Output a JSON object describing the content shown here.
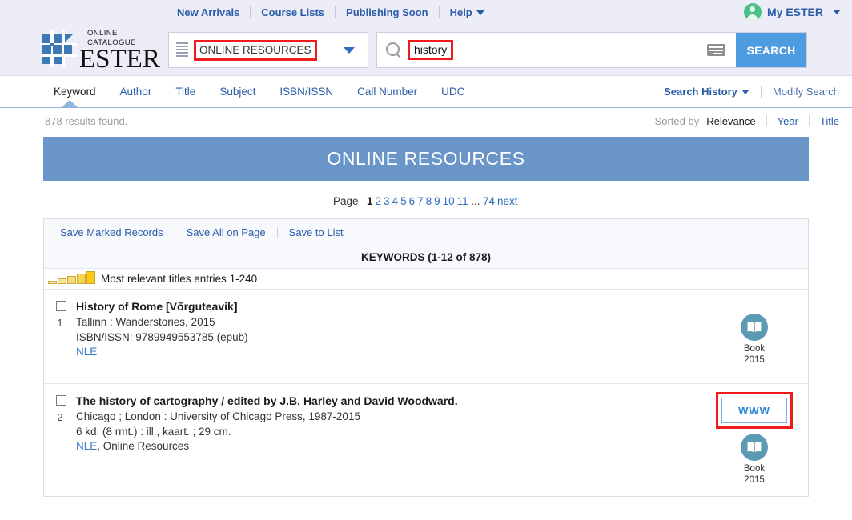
{
  "header": {
    "utility_nav": [
      {
        "label": "New Arrivals",
        "icon": null
      },
      {
        "label": "Course Lists",
        "icon": null
      },
      {
        "label": "Publishing Soon",
        "icon": null
      },
      {
        "label": "Help",
        "icon": "chevron-down-icon"
      }
    ],
    "account": {
      "label": "My ESTER",
      "avatar_icon": "user-avatar-icon",
      "avatar_color": "#4dc08a",
      "caret_icon": "chevron-down-icon"
    },
    "logo": {
      "subtitle": "ONLINE CATALOGUE",
      "title": "ESTER",
      "mark_icon": "ester-grid-logo-icon",
      "mark_color": "#3d79b5"
    },
    "scope_select": {
      "menu_icon": "hamburger-icon",
      "value": "ONLINE RESOURCES",
      "arrow_icon": "chevron-down-icon",
      "highlight_color": "#ee1c1c"
    },
    "search": {
      "search_icon": "magnifier-icon",
      "value": "history",
      "keyboard_icon": "virtual-keyboard-icon",
      "button_label": "SEARCH",
      "button_color": "#4d9ce0",
      "highlight_color": "#ee1c1c"
    },
    "band_color": "#ecedf7"
  },
  "tabbar": {
    "tabs": [
      {
        "label": "Keyword",
        "active": true
      },
      {
        "label": "Author",
        "active": false
      },
      {
        "label": "Title",
        "active": false
      },
      {
        "label": "Subject",
        "active": false
      },
      {
        "label": "ISBN/ISSN",
        "active": false
      },
      {
        "label": "Call Number",
        "active": false
      },
      {
        "label": "UDC",
        "active": false
      }
    ],
    "search_history": "Search History",
    "search_history_icon": "chevron-down-icon",
    "modify_search": "Modify Search"
  },
  "meta": {
    "results_found": "878 results found.",
    "sorted_by_label": "Sorted by",
    "sort_options": [
      {
        "label": "Relevance",
        "active": true
      },
      {
        "label": "Year",
        "active": false
      },
      {
        "label": "Title",
        "active": false
      }
    ]
  },
  "banner": {
    "title": "ONLINE RESOURCES",
    "color": "#6a95c9"
  },
  "pager": {
    "label": "Page",
    "current": "1",
    "pages": [
      "2",
      "3",
      "4",
      "5",
      "6",
      "7",
      "8",
      "9",
      "10",
      "11"
    ],
    "ellipsis": "...",
    "last": "74",
    "next": "next"
  },
  "save_bar": {
    "actions": [
      "Save Marked Records",
      "Save All on Page",
      "Save to List"
    ]
  },
  "results": {
    "heading": "KEYWORDS (1-12 of 878)",
    "relevance_note": "Most relevant titles entries 1-240",
    "relevance_icon": "relevance-bars-icon",
    "records": [
      {
        "number": "1",
        "checkbox_icon": "checkbox-unchecked-icon",
        "title": "History of Rome [Võrguteavik]",
        "imprint": "Tallinn : Wanderstories, 2015",
        "isbn_label": "ISBN/ISSN:",
        "isbn_value": "9789949553785 (epub)",
        "locations": [
          {
            "text": "NLE",
            "link": true
          },
          {
            "text": ", Online Resources",
            "link": false,
            "hidden": true
          }
        ],
        "location_link": "NLE",
        "location_rest": "",
        "www_button": null,
        "media": {
          "icon": "open-book-icon",
          "label": "Book",
          "year": "2015",
          "color": "#5b9ab3"
        }
      },
      {
        "number": "2",
        "checkbox_icon": "checkbox-unchecked-icon",
        "title": "The history of cartography / edited by J.B. Harley and David Woodward.",
        "imprint": "Chicago ; London : University of Chicago Press, 1987-2015",
        "isbn_label": "",
        "isbn_value": "6 kd. (8 rmt.) : ill., kaart. ; 29 cm.",
        "location_link": "NLE",
        "location_rest": ", Online Resources",
        "www_button": {
          "label": "WWW",
          "highlight_color": "#ee1c1c"
        },
        "media": {
          "icon": "open-book-icon",
          "label": "Book",
          "year": "2015",
          "color": "#5b9ab3"
        }
      }
    ]
  }
}
